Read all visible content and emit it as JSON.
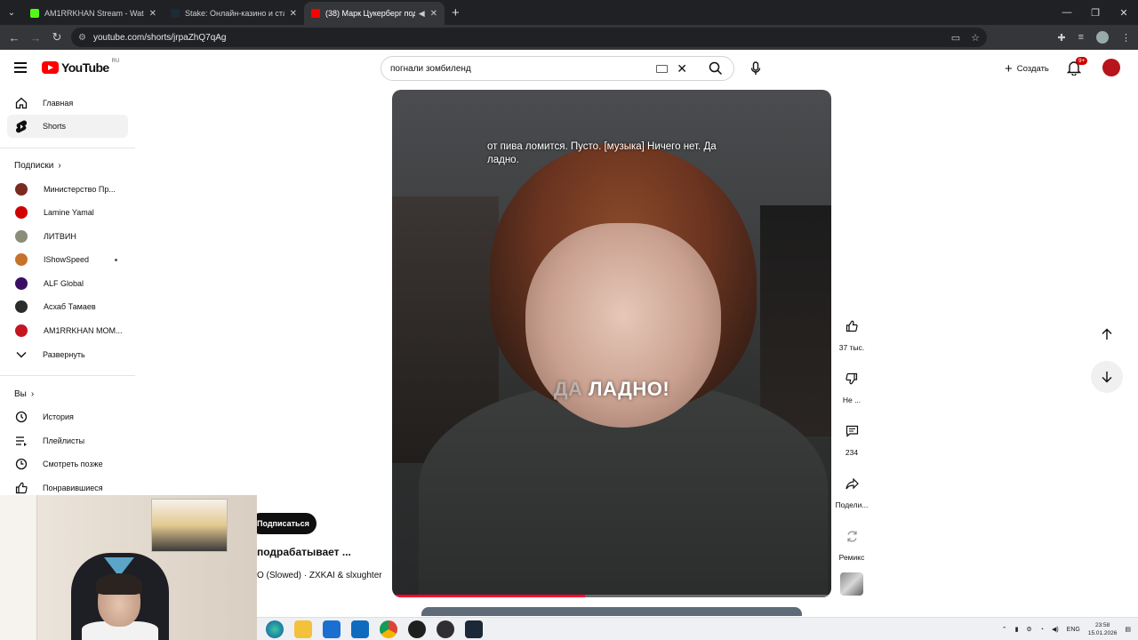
{
  "browser": {
    "tabs": [
      {
        "label": "AM1RRKHAN Stream - Watch L",
        "favicon_color": "#53fc18",
        "active": false
      },
      {
        "label": "Stake: Онлайн-казино и ставк",
        "favicon_color": "#1a2c38",
        "active": false
      },
      {
        "label": "(38) Марк Цукерберг подр",
        "favicon_color": "#ff0000",
        "active": true
      }
    ],
    "url": "youtube.com/shorts/jrpaZhQ7qAg"
  },
  "header": {
    "logo_text": "YouTube",
    "region": "RU",
    "search_value": "погнали зомбиленд",
    "create_label": "Создать",
    "notification_badge": "9+"
  },
  "sidebar": {
    "main": [
      {
        "label": "Главная",
        "icon": "home-icon"
      },
      {
        "label": "Shorts",
        "icon": "shorts-icon",
        "active": true
      }
    ],
    "subscriptions_heading": "Подписки",
    "subscriptions": [
      {
        "label": "Министерство Пр...",
        "color": "#7a2a1e"
      },
      {
        "label": "Lamine Yamal",
        "color": "#d20000"
      },
      {
        "label": "ЛИТВИН",
        "color": "#8c8c7a"
      },
      {
        "label": "IShowSpeed",
        "color": "#c7722a",
        "new": true
      },
      {
        "label": "ALF Global",
        "color": "#3a0f63"
      },
      {
        "label": "Асхаб Тамаев",
        "color": "#2b2b2b"
      },
      {
        "label": "AM1RRKHAN MOM...",
        "color": "#c41620"
      }
    ],
    "expand_label": "Развернуть",
    "you_heading": "Вы",
    "you_items": [
      {
        "label": "История",
        "icon": "history-icon"
      },
      {
        "label": "Плейлисты",
        "icon": "playlists-icon"
      },
      {
        "label": "Смотреть позже",
        "icon": "watch-later-icon"
      },
      {
        "label": "Понравившиеся",
        "icon": "liked-icon"
      }
    ]
  },
  "video": {
    "caption": "от пива ломится. Пусто. [музыка] Ничего нет. Да ладно.",
    "burned_text_dim": "ДА",
    "burned_text": "ЛАДНО!",
    "progress": 0.44
  },
  "actions": {
    "like_count": "37 тыс.",
    "dislike_label": "Не ...",
    "comments_count": "234",
    "share_label": "Подели...",
    "remix_label": "Ремикс"
  },
  "meta": {
    "subscribe_label": "Подписаться",
    "title": "подрабатывает ...",
    "music": "O (Slowed) · ZXKAI & slxughter"
  },
  "taskbar": {
    "lang": "ENG",
    "time": "23:58",
    "date": "15.01.2026"
  }
}
